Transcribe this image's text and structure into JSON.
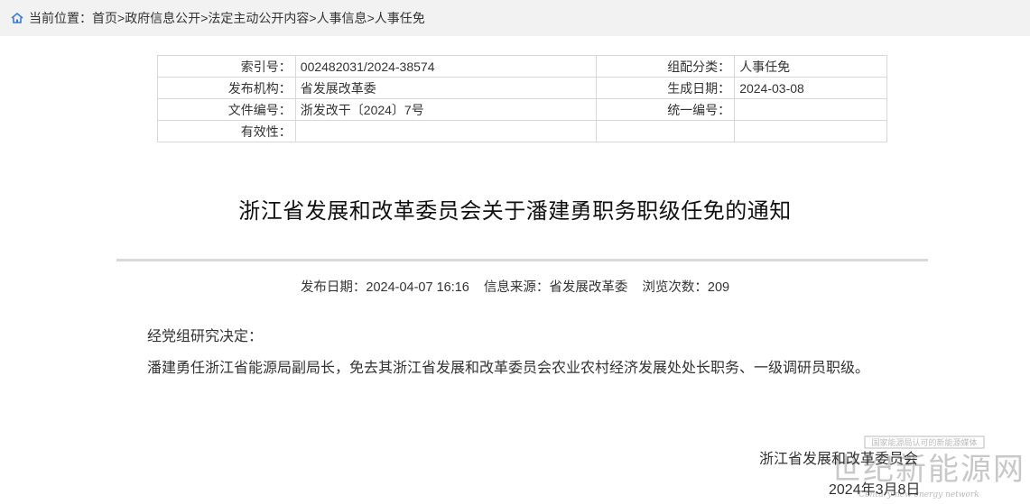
{
  "breadcrumb": {
    "prefix": "当前位置：",
    "items": [
      "首页",
      "政府信息公开",
      "法定主动公开内容",
      "人事信息",
      "人事任免"
    ],
    "separator": ">"
  },
  "meta": {
    "rows": [
      {
        "l1": "索引号：",
        "v1": "002482031/2024-38574",
        "l2": "组配分类：",
        "v2": "人事任免"
      },
      {
        "l1": "发布机构：",
        "v1": "省发展改革委",
        "l2": "生成日期：",
        "v2": "2024-03-08"
      },
      {
        "l1": "文件编号：",
        "v1": "浙发改干〔2024〕7号",
        "l2": "统一编号：",
        "v2": ""
      },
      {
        "l1": "有效性：",
        "v1": "",
        "l2": "",
        "v2": ""
      }
    ]
  },
  "article": {
    "title": "浙江省发展和改革委员会关于潘建勇职务职级任免的通知",
    "publish_date": "发布日期：2024-04-07 16:16",
    "source": "信息来源：省发展改革委",
    "views": "浏览次数：209",
    "paragraphs": [
      "经党组研究决定：",
      "潘建勇任浙江省能源局副局长，免去其浙江省发展和改革委员会农业农村经济发展处处长职务、一级调研员职级。"
    ],
    "signature_org": "浙江省发展和改革委员会",
    "signature_date": "2024年3月8日"
  },
  "watermark": {
    "top_text": "国家能源局认可的新能源媒体",
    "main_text": "世纪新能源网",
    "sub_text": "Century new energy network"
  },
  "colors": {
    "breadcrumb_bg": "#f2f2f2",
    "border": "#d9d9d9",
    "home_icon": "#3a7bd5"
  }
}
